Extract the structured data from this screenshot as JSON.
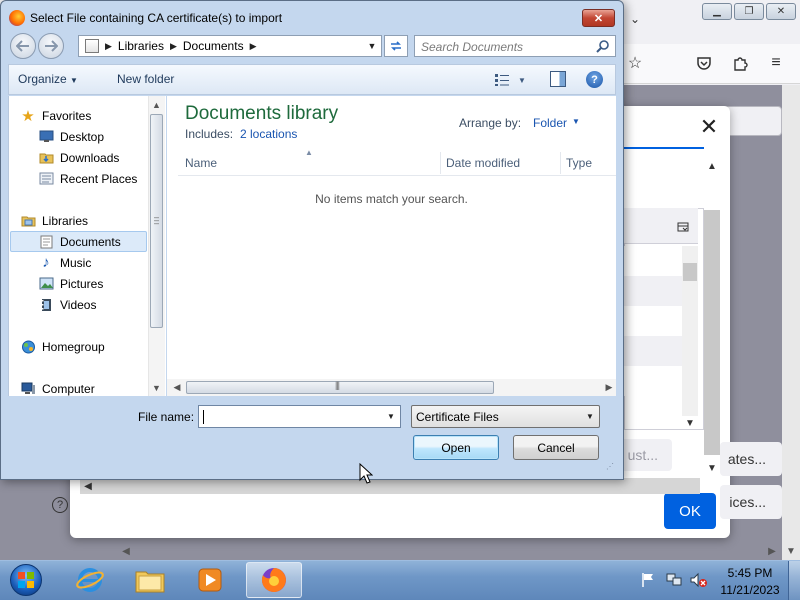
{
  "file_dialog": {
    "title": "Select File containing CA certificate(s) to import",
    "close_label": "✕",
    "address": {
      "crumbs": [
        "Libraries",
        "Documents"
      ]
    },
    "search_placeholder": "Search Documents",
    "toolbar": {
      "organize": "Organize",
      "new_folder": "New folder",
      "help": "?"
    },
    "nav": {
      "favorites": {
        "label": "Favorites",
        "items": [
          "Desktop",
          "Downloads",
          "Recent Places"
        ]
      },
      "libraries": {
        "label": "Libraries",
        "items": [
          "Documents",
          "Music",
          "Pictures",
          "Videos"
        ]
      },
      "homegroup": "Homegroup",
      "computer": "Computer"
    },
    "library": {
      "title": "Documents library",
      "includes_label": "Includes:",
      "locations_link": "2 locations",
      "arrange_label": "Arrange by:",
      "arrange_value": "Folder"
    },
    "columns": [
      "Name",
      "Date modified",
      "Type"
    ],
    "empty_message": "No items match your search.",
    "file_name_label": "File name:",
    "file_name_value": "",
    "file_type": "Certificate Files",
    "buttons": {
      "open": "Open",
      "cancel": "Cancel"
    }
  },
  "background": {
    "cert_dialog": {
      "close_label": "✕",
      "trust_button_partial": "ust...",
      "side_buttons": [
        "ates...",
        "ices..."
      ],
      "help": "?",
      "ok": "OK"
    },
    "accent": "#0061e0"
  },
  "taskbar": {
    "time": "5:45 PM",
    "date": "11/21/2023"
  }
}
